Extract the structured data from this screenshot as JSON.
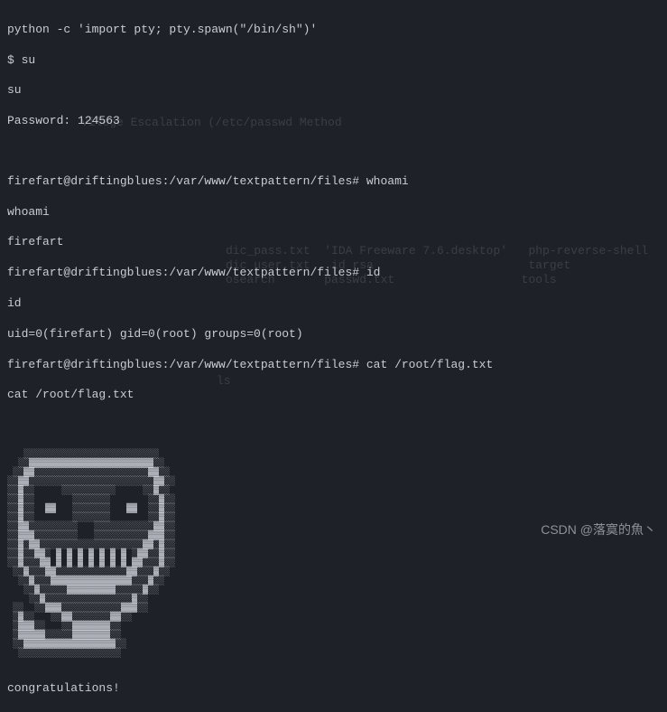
{
  "terminal": {
    "lines": [
      "python -c 'import pty; pty.spawn(\"/bin/sh\")'",
      "$ su",
      "su",
      "Password: 124563",
      "",
      "firefart@driftingblues:/var/www/textpattern/files# whoami",
      "whoami",
      "firefart",
      "firefart@driftingblues:/var/www/textpattern/files# id",
      "id",
      "uid=0(firefart) gid=0(root) groups=0(root)",
      "firefart@driftingblues:/var/www/textpattern/files# cat /root/flag.txt",
      "cat /root/flag.txt"
    ],
    "congrats": "congratulations!"
  },
  "background": {
    "bg1": "vilege Escalation (/etc/passwd Method ",
    "bg2": "dic_pass.txt  'IDA Freeware 7.6.desktop'   php-reverse-shell",
    "bg3": "dic_user.txt   id_rsa                      target",
    "bg4": "osearch       passwd.txt                  tools",
    "bg5": "ls"
  },
  "watermark": "CSDN @落寞的魚丶",
  "ascii_art": "   ░░░░░░░░░░░░░░░░░░░░░░░░░\n  ░░▓▓▓▓▓▓▓▓▓▓▓▓▓▓▓▓▓▓▓▓▓▓▓░░\n ░░▓▓░░░░░░░░░░░░░░░░░░░░░▓▓░░\n░░▓▓░░░░░░░░░░░░░░░░░░░░░░░▓▓░░\n░░▓░░     ░░░░░░░░░░     ░░▓░░\n░░▓░░       ░░░░░░░       ░░▓░░\n░░▓░░  ▓▓   ░░░░░░░   ▓▓  ░░▓░░\n░░▓░░       ░░░░░░░       ░░▓░░\n░░▓▓░░░░░░░░░   ░░░░░░░░░░░▓▓░░\n░░▓▓▓░░░░░░░░   ░░░░░░░░░░▓▓▓░░\n░░▓░▓▓░░░░░░░░░░░░░░░░░░░▓▓░▓░░\n░░▓░░▓▓░ ▓ ▓ ▓ ▓ ▓ ▓ ▓ ░▓▓░░▓░░\n░░▓░░░▓▓ ▓ ▓ ▓ ▓ ▓ ▓ ▓ ▓▓░░░▓░░\n ░░▓░░░▓▓░░░░░░░░░░░░░▓▓░░░▓░░\n  ░░▓░░░▓▓▓▓▓▓▓▓▓▓▓▓▓▓▓░░░▓░░\n   ░░▓░░░░░▓▓▓▓▓▓▓▓▓░░░░░▓░░\n    ░░▓░░░░░░░░░░░░░░░░▓░░\n ░░  ░░▓▓▓░░░░░░░░░░░▓▓▓░░\n ░▓░░   ░░▓▓░░░░░░░▓▓░░\n ░▓▓▓░░   ░░▓▓▓▓▓▓▓░░\n ░▓▓▓▓▓░░░░░▓▓▓▓▓▓▓░░\n ░░▓▓▓▓▓▓▓▓▓▓▓▓▓▓▓▓▓░░\n  ░░░░░░░░░░░░░░░░░░░"
}
